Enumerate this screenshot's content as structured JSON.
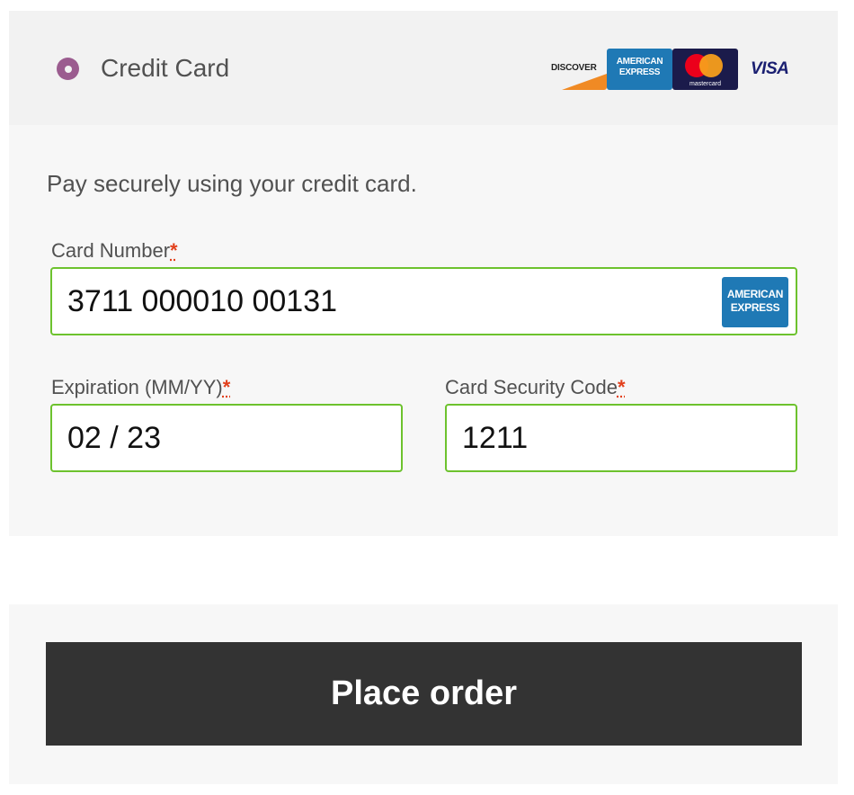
{
  "payment_method": {
    "label": "Credit Card",
    "logos": {
      "discover": "DISCOVER",
      "amex_line1": "AMERICAN",
      "amex_line2": "EXPRESS",
      "mastercard": "mastercard",
      "visa": "VISA"
    }
  },
  "description": "Pay securely using your credit card.",
  "card_number": {
    "label": "Card Number",
    "required": "*",
    "value": "3711 000010 00131",
    "detected_brand_line1": "AMERICAN",
    "detected_brand_line2": "EXPRESS"
  },
  "expiration": {
    "label": "Expiration (MM/YY)",
    "required": "*",
    "value": "02 / 23"
  },
  "security_code": {
    "label": "Card Security Code",
    "required": "*",
    "value": "1211"
  },
  "place_order_label": "Place order",
  "colors": {
    "radio": "#9b5c8f",
    "input_border_valid": "#6dc22e",
    "required_mark": "#e2401c",
    "button_bg": "#333333",
    "amex_blue": "#1f79b5"
  }
}
